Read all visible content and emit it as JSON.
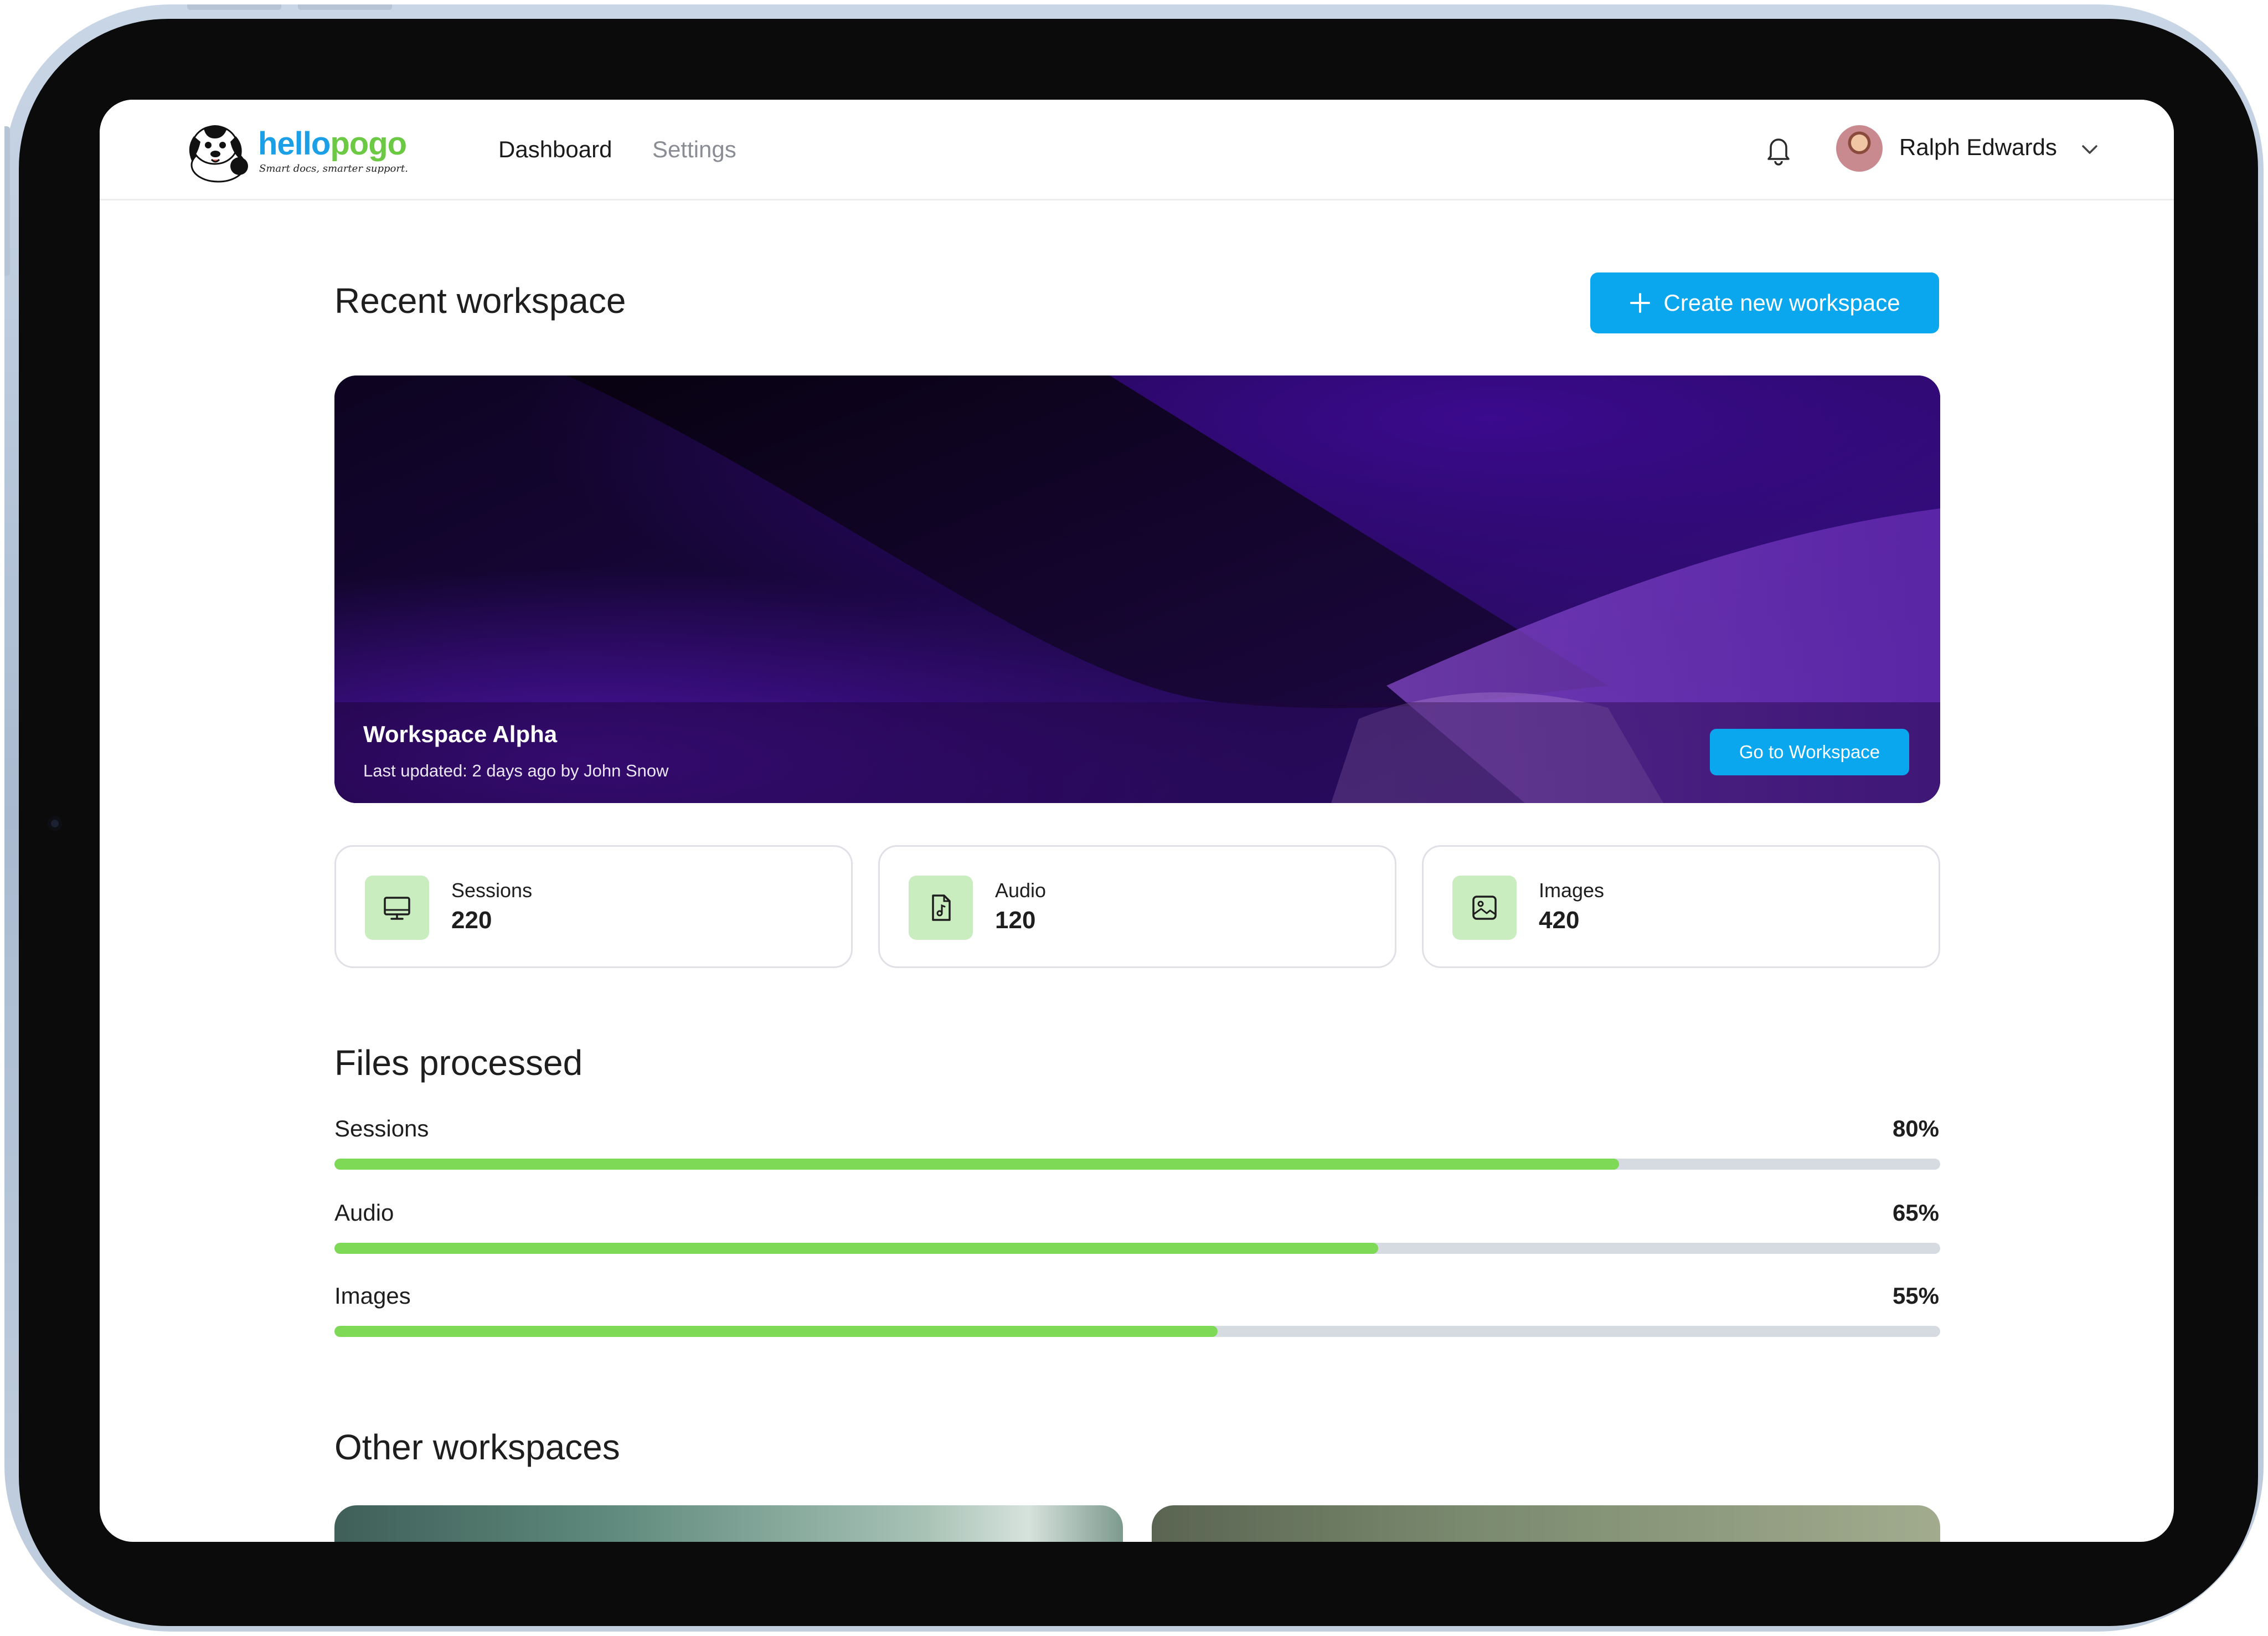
{
  "header": {
    "logo": {
      "name_part1": "hello",
      "name_part2": "pogo",
      "tagline": "Smart docs, smarter support."
    },
    "nav": [
      {
        "label": "Dashboard",
        "active": true
      },
      {
        "label": "Settings",
        "active": false
      }
    ],
    "user": {
      "name": "Ralph Edwards"
    }
  },
  "recent": {
    "title": "Recent workspace",
    "create_label": "Create new workspace",
    "hero": {
      "title": "Workspace Alpha",
      "subtitle": "Last updated: 2 days ago by John Snow",
      "button_label": "Go to Workspace"
    }
  },
  "stats": [
    {
      "label": "Sessions",
      "value": "220",
      "icon": "monitor-icon"
    },
    {
      "label": "Audio",
      "value": "120",
      "icon": "audio-file-icon"
    },
    {
      "label": "Images",
      "value": "420",
      "icon": "image-icon"
    }
  ],
  "files": {
    "title": "Files processed",
    "items": [
      {
        "label": "Sessions",
        "percent_label": "80%",
        "percent": 80
      },
      {
        "label": "Audio",
        "percent_label": "65%",
        "percent": 65
      },
      {
        "label": "Images",
        "percent_label": "55%",
        "percent": 55
      }
    ]
  },
  "other": {
    "title": "Other workspaces"
  },
  "colors": {
    "accent": "#0aa7ef",
    "progress": "#7ed957",
    "icon_bg": "#c9edbf"
  }
}
